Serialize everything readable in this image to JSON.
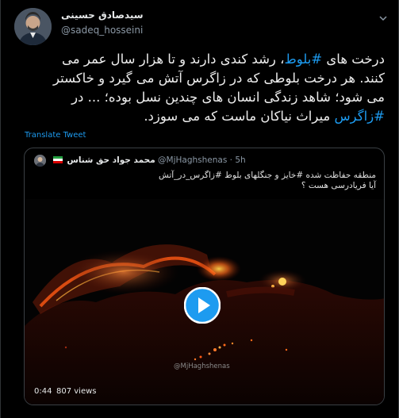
{
  "tweet": {
    "author_name": "سیدصادق حسینی",
    "author_handle": "@sadeq_hosseini",
    "line1_pre": "درخت های ",
    "line1_hashtag": "#بلوط",
    "line1_post": "، رشد کندی دارند و تا هزار سال عمر می",
    "line2": "کنند. هر درخت بلوطی که در زاگرس آتش می گیرد و خاکستر",
    "line3": "می شود؛ شاهد زندگی انسان های چندین نسل بوده؛ ... در",
    "line4_hashtag": "#زاگرس",
    "line4_post": " میراث نیاکان ماست که می سوزد.",
    "translate_label": "Translate Tweet"
  },
  "quote": {
    "author_name": "محمد جواد حق شناس",
    "author_handle": "@MjHaghshenas",
    "time": "5h",
    "text_line1": "منطقه حفاظت شده #خایز و جنگلهای بلوط #زاگرس_در_آتش",
    "text_line2": "آیا فریادرسی هست ؟",
    "video": {
      "watermark": "@MjHaghshenas",
      "duration": "0:44",
      "views": "807 views"
    }
  },
  "colors": {
    "link": "#1d9bf0",
    "background": "#000000",
    "border": "#2f3336"
  }
}
